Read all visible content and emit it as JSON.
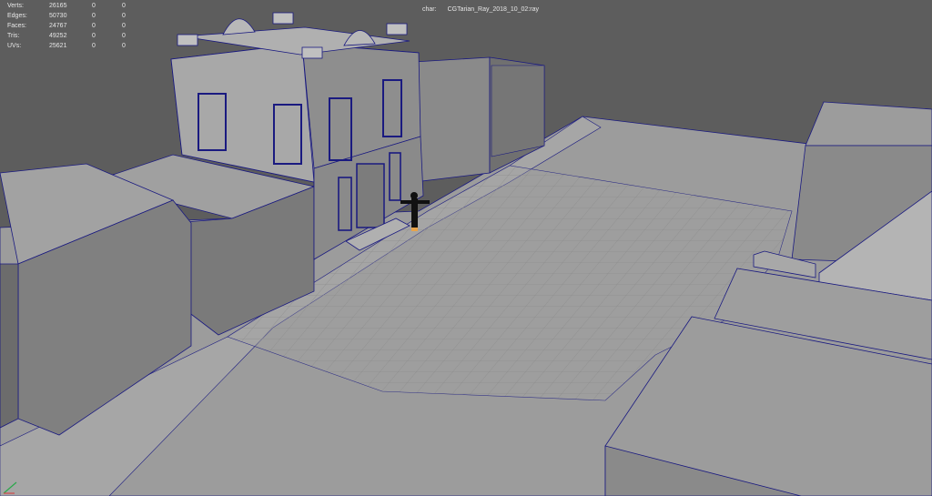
{
  "hud": {
    "stats": [
      {
        "label": "Verts:",
        "values": [
          "26165",
          "0",
          "0"
        ]
      },
      {
        "label": "Edges:",
        "values": [
          "50730",
          "0",
          "0"
        ]
      },
      {
        "label": "Faces:",
        "values": [
          "24767",
          "0",
          "0"
        ]
      },
      {
        "label": "Tris:",
        "values": [
          "49252",
          "0",
          "0"
        ]
      },
      {
        "label": "UVs:",
        "values": [
          "25621",
          "0",
          "0"
        ]
      }
    ],
    "char_label": "char:",
    "char_value": "CGTarian_Ray_2018_10_02:ray"
  },
  "viewport": {
    "background": "#5d5d5d",
    "ground_color": "#9e9e9e",
    "wireframe_color": "#1a1a80",
    "icons": [
      "view-axis-icon"
    ]
  }
}
